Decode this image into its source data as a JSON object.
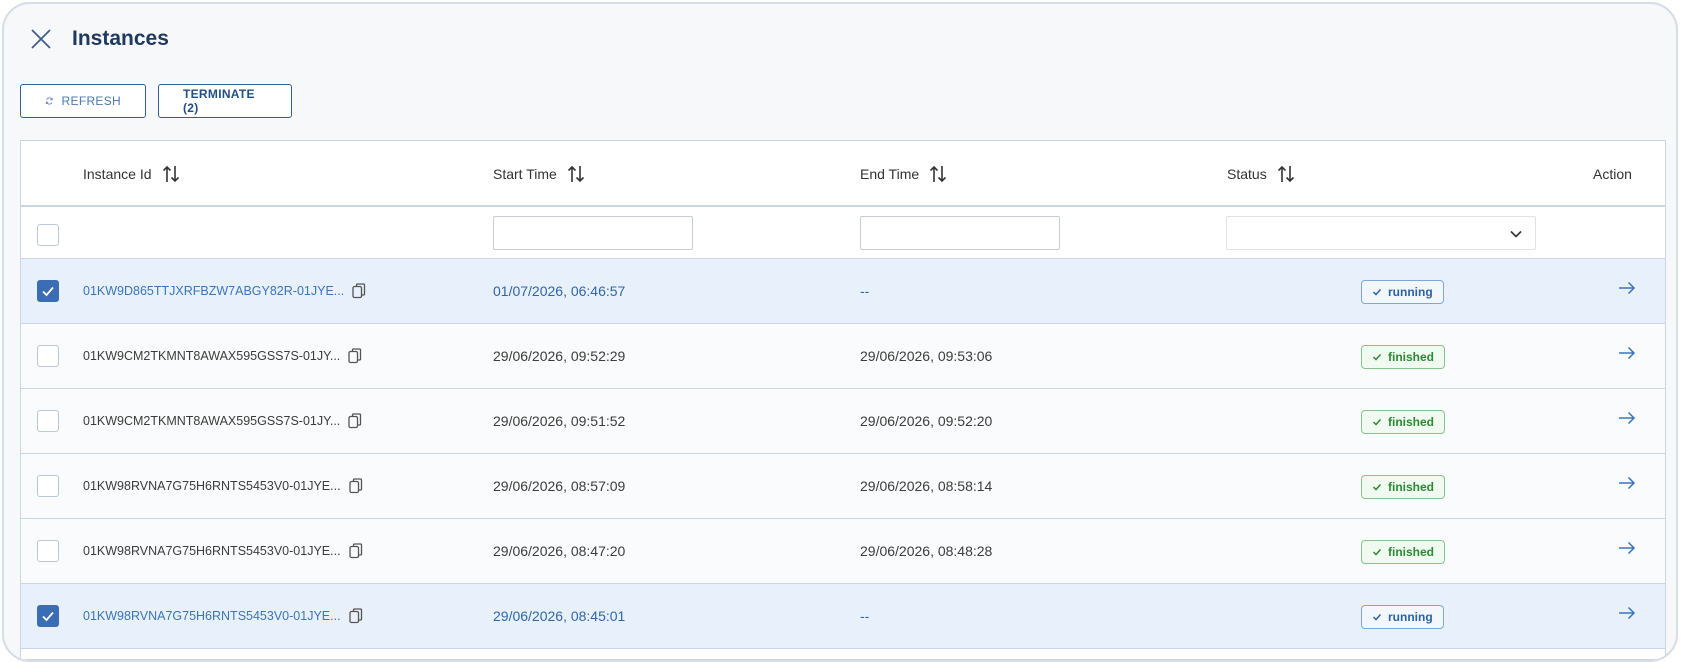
{
  "header": {
    "title": "Instances"
  },
  "toolbar": {
    "refresh_label": "REFRESH",
    "terminate_label": "TERMINATE (2)"
  },
  "table": {
    "columns": {
      "instance_id": "Instance Id",
      "start_time": "Start Time",
      "end_time": "End Time",
      "status": "Status",
      "action": "Action"
    },
    "rows": [
      {
        "id": "01KW9D865TTJXRFBZW7ABGY82R-01JYE...",
        "start": "01/07/2026, 06:46:57",
        "end": "--",
        "status": "running",
        "selected": true
      },
      {
        "id": "01KW9CM2TKMNT8AWAX595GSS7S-01JY...",
        "start": "29/06/2026, 09:52:29",
        "end": "29/06/2026, 09:53:06",
        "status": "finished",
        "selected": false
      },
      {
        "id": "01KW9CM2TKMNT8AWAX595GSS7S-01JY...",
        "start": "29/06/2026, 09:51:52",
        "end": "29/06/2026, 09:52:20",
        "status": "finished",
        "selected": false
      },
      {
        "id": "01KW98RVNA7G75H6RNTS5453V0-01JYE...",
        "start": "29/06/2026, 08:57:09",
        "end": "29/06/2026, 08:58:14",
        "status": "finished",
        "selected": false
      },
      {
        "id": "01KW98RVNA7G75H6RNTS5453V0-01JYE...",
        "start": "29/06/2026, 08:47:20",
        "end": "29/06/2026, 08:48:28",
        "status": "finished",
        "selected": false
      },
      {
        "id": "01KW98RVNA7G75H6RNTS5453V0-01JYE...",
        "start": "29/06/2026, 08:45:01",
        "end": "--",
        "status": "running",
        "selected": true
      }
    ]
  },
  "icons": {
    "close": "close-icon",
    "refresh": "refresh-icon",
    "sort": "sort-icon",
    "copy": "copy-icon",
    "check": "check-icon",
    "arrow": "arrow-right-icon",
    "chevron": "chevron-down-icon"
  },
  "colors": {
    "accent": "#3a6db3",
    "running": "#2c63a6",
    "finished": "#2c8a35",
    "selected_row": "#e8f1fb"
  }
}
